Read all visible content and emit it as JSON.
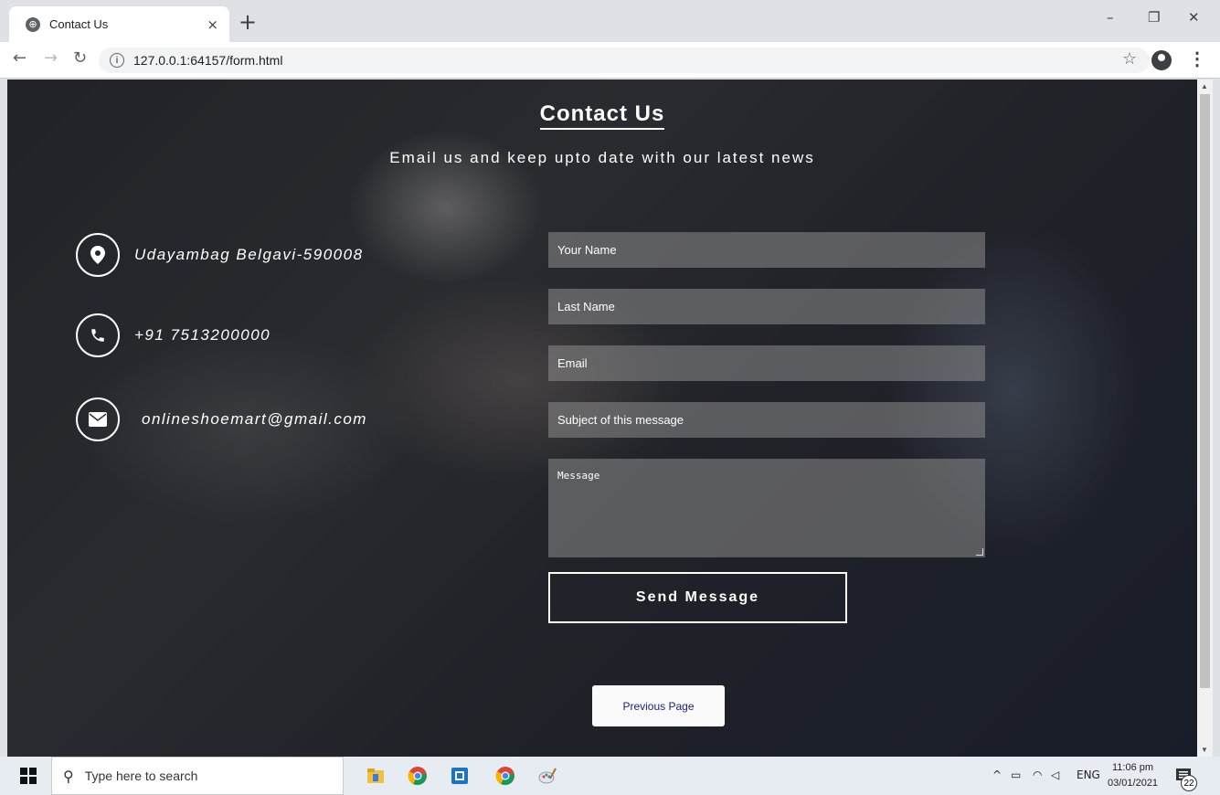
{
  "browser": {
    "tab_title": "Contact Us",
    "tab_close": "×",
    "new_tab": "+",
    "url": "127.0.0.1:64157/form.html",
    "minimize": "–",
    "restore": "❐",
    "close": "✕"
  },
  "page": {
    "title": "Contact Us",
    "subtitle": "Email us and keep upto date with our latest news",
    "address": "Udayambag Belgavi-590008",
    "phone": "+91 7513200000",
    "email": "onlineshoemart@gmail.com",
    "form": {
      "first_name_placeholder": "Your Name",
      "last_name_placeholder": "Last Name",
      "email_placeholder": "Email",
      "subject_placeholder": "Subject of this message",
      "message_placeholder": "Message",
      "send_label": "Send Message"
    },
    "previous_page_label": "Previous Page"
  },
  "taskbar": {
    "search_placeholder": "Type here to search",
    "language": "ENG",
    "time": "11:06 pm",
    "date": "03/01/2021",
    "notification_count": "22"
  }
}
